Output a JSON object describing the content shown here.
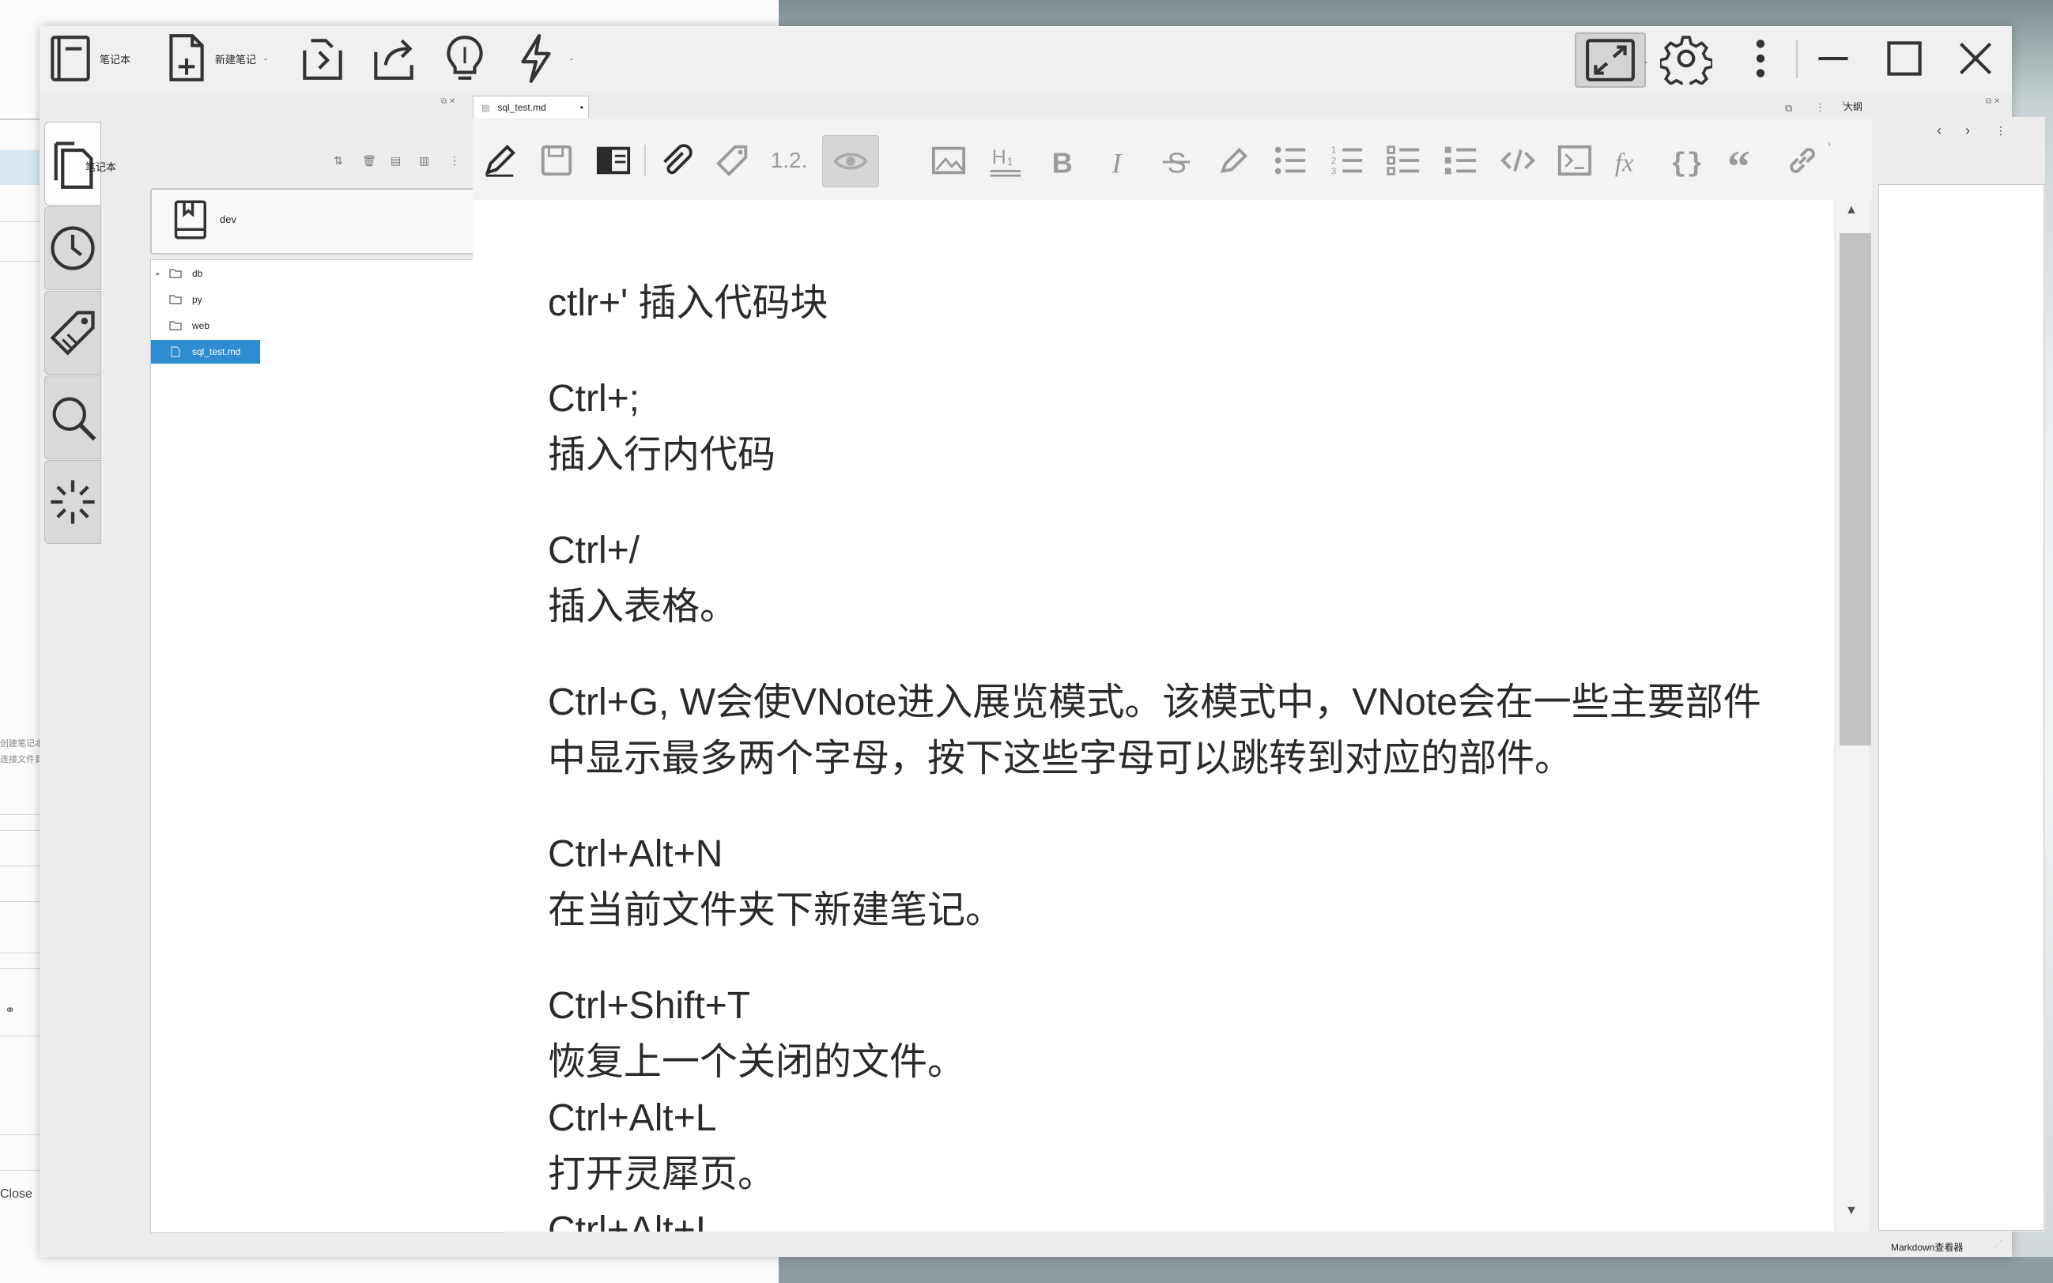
{
  "toolbar": {
    "notebook_label": "笔记本",
    "new_note_label": "新建笔记",
    "dropdown_mark": "-"
  },
  "background": {
    "left_hint_1": "创建笔记本",
    "left_hint_2": "连接文件到",
    "left_close": "Close"
  },
  "notebook_panel": {
    "title": "笔记本",
    "current_notebook": "dev",
    "tree": [
      {
        "label": "db",
        "type": "folder",
        "expandable": true,
        "selected": false
      },
      {
        "label": "py",
        "type": "folder",
        "expandable": false,
        "selected": false
      },
      {
        "label": "web",
        "type": "folder",
        "expandable": false,
        "selected": false
      },
      {
        "label": "sql_test.md",
        "type": "file",
        "expandable": false,
        "selected": true
      }
    ]
  },
  "editor": {
    "tab_title": "sql_test.md",
    "heading_level_hint": "1.2.",
    "lines": [
      {
        "text": "ctlr+' 插入代码块"
      },
      {
        "text": "Ctrl+;"
      },
      {
        "text": "插入行内代码"
      },
      {
        "text": "Ctrl+/"
      },
      {
        "text": "插入表格。"
      },
      {
        "text": "Ctrl+G, W会使VNote进入展览模式。该模式中，VNote会在一些主要部件中显示最多两个字母，按下这些字母可以跳转到对应的部件。"
      },
      {
        "text": "Ctrl+Alt+N"
      },
      {
        "text": "在当前文件夹下新建笔记。"
      },
      {
        "text": "Ctrl+Shift+T"
      },
      {
        "text": "恢复上一个关闭的文件。"
      },
      {
        "text": "Ctrl+Alt+L"
      },
      {
        "text": "打开灵犀页。"
      },
      {
        "text": "Ctrl+Alt+I"
      }
    ]
  },
  "outline_panel": {
    "title": "大纲"
  },
  "statusbar": {
    "viewer_mode": "Markdown查看器"
  },
  "colors": {
    "selection": "#2f8cd0",
    "window_bg": "#ececec",
    "editor_bg": "#ffffff"
  },
  "icons": [
    "notebook-icon",
    "new-note-icon",
    "import-icon",
    "export-icon",
    "tips-icon",
    "flash-icon",
    "fullscreen-icon",
    "gear-icon",
    "more-icon",
    "minimize-icon",
    "maximize-icon",
    "close-icon",
    "file-icon",
    "history-icon",
    "tag-icon",
    "search-icon",
    "snippet-icon"
  ]
}
